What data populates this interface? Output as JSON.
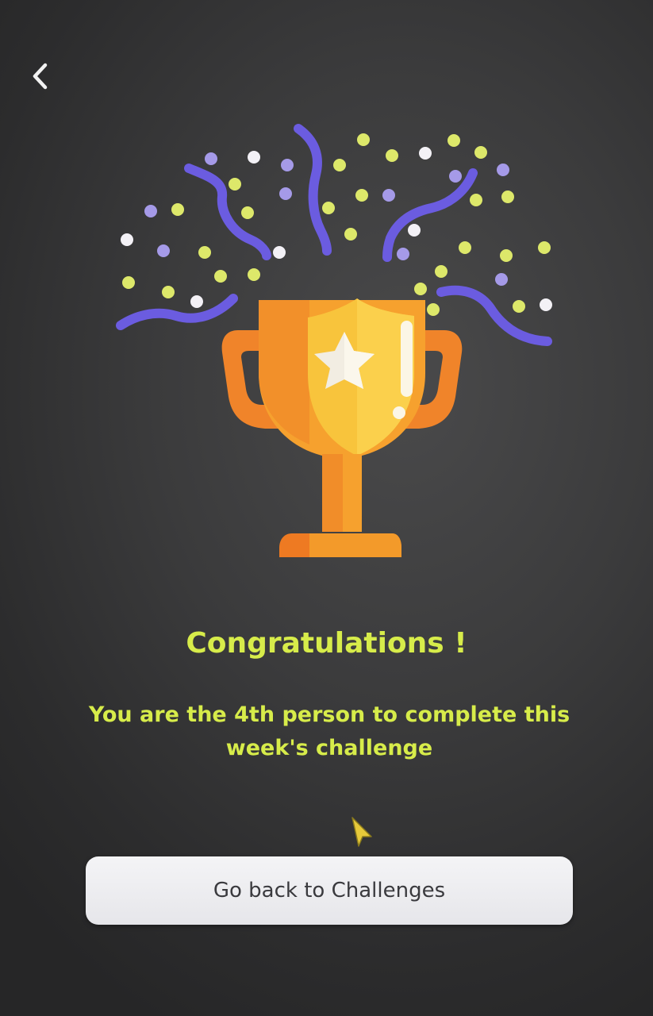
{
  "colors": {
    "background": "#3a3a3b",
    "accent_text": "#d7ec4a",
    "button_bg": "#eeeef1",
    "button_text": "#3a3a3e",
    "confetti_purple": "#6b5ce0",
    "confetti_yellow": "#dde86a",
    "confetti_white": "#f3f1f6",
    "trophy_orange": "#f39a2a",
    "trophy_dark": "#e9771f",
    "trophy_light": "#f8c43c"
  },
  "header": {
    "back_icon": "chevron-left-icon"
  },
  "illustration": {
    "icon": "trophy-icon",
    "decoration": "confetti"
  },
  "main": {
    "title": "Congratulations !",
    "message": "You are the 4th person to complete this week's challenge"
  },
  "actions": {
    "primary_label": "Go back to Challenges"
  }
}
